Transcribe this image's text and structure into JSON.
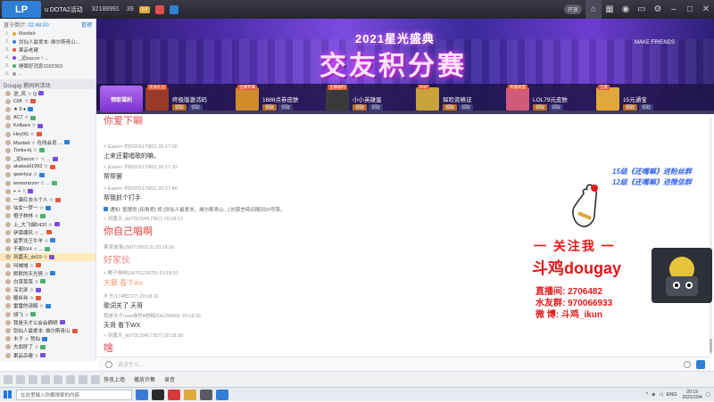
{
  "topbar": {
    "room_title": "u DOTA2活动",
    "room_id": "32188991",
    "fans": "39",
    "level": "Lv",
    "switch_label": "开放",
    "buttons": [
      "home-icon",
      "grid-icon",
      "gamepad-icon",
      "monitor-icon",
      "settings-icon",
      "minimize-icon",
      "maximize-icon",
      "close-icon"
    ]
  },
  "left_panel": {
    "header_label": "直守倒计:",
    "header_time": "02:48:00",
    "header_link": "管理",
    "rank": [
      {
        "num": "1.",
        "name": "Mardah"
      },
      {
        "num": "2.",
        "name": "剑仙人最爱本: 维尔斯青山..."
      },
      {
        "num": "3.",
        "name": "果品老建"
      },
      {
        "num": "4.",
        "name": "_远bacon丶..."
      },
      {
        "num": "5.",
        "name": "睡眠好消息1002363"
      },
      {
        "num": "6.",
        "name": "..."
      }
    ],
    "section_label": "Dougay 鹅妈妈活动",
    "users": [
      "逆_风 ☆ Q",
      "Cliff. ☆",
      "★ 9 ♦",
      "AC7 ☆",
      "Kelbara ☆",
      "Hey0G ☆",
      "Mardah ☆ 在线会员 ...",
      "Tonks-kj ☆",
      "_远bacon丶 ☆ ...",
      "akatsuki1993 ☆",
      "qwertyui ☆",
      "wowsnizzer ☆ ...",
      "+ + ☆",
      "一袭红衣斗个人 ☆",
      "仙女一梦一 ☆",
      "橙子林林 ☆",
      "上_大飞烟5420 ☆",
      "伊荣绷风 ☆ ...",
      "留罗兆王牛羊 ☆",
      "千都5X4 ☆ ...",
      "到嘉天_dd19 ☆",
      "叫喊喊 ☆",
      "默默的天光情 ☆",
      "白菜菜菜 ☆",
      "深北柒 ☆",
      "暖丝丝 ☆",
      "雷雷的请解 ☆",
      "胡飞 ☆",
      "我是天才公会会摘明",
      "剑仙人最爱本: 维尔斯青山",
      "木子 ☆ 赞仙",
      "杰朋肝了 ☆",
      "果品杂建 ☆",
      "锯香 ☆"
    ]
  },
  "banner": {
    "year_title": "2021星光盛典",
    "main_title": "交友积分赛",
    "partner": "MAKE FRIENDS",
    "first_label": "领取福利",
    "gifts": [
      {
        "tag": "充值礼包",
        "name": "终极版激活码"
      },
      {
        "tag": "主播专属",
        "name": "1688点券皮肤"
      },
      {
        "tag": "主播福利",
        "name": "小小英雄蛋"
      },
      {
        "tag": "DNF",
        "name": "探险资格证"
      },
      {
        "tag": "英雄联盟",
        "name": "LOL79元皮肤"
      },
      {
        "tag": "王者",
        "name": "15元通宝"
      }
    ],
    "btn_claim": "领取",
    "btn_get": "领取"
  },
  "chat": {
    "cut_top": "你爱下唰",
    "messages": [
      {
        "meta": "< Eason~刘(620117982) 20:17:26",
        "text": "上来还要唱歌的嘛。",
        "style": "normal"
      },
      {
        "meta": "< Eason~刘(620117982) 20:17:33",
        "text": "帮帮罢",
        "style": "normal"
      },
      {
        "meta": "< Eason~刘(620117982) 20:17:40",
        "text": "帮我抓个打手",
        "style": "normal"
      },
      {
        "meta": "",
        "text": "通知: 管理员 [街角呢] 将 [剑仙人最爱本、维尔斯青山...] 的禁言時间隔到20号禁。",
        "style": "sys"
      },
      {
        "meta": "< 到嘉天_dd7f2(39417957) 20:18:12",
        "text": "你自己唱啊",
        "style": "red"
      },
      {
        "meta": "果茶故事(2607790213) 20:18:16",
        "text": "好家伙",
        "style": "pink"
      },
      {
        "meta": "< 椰子林林(2475123675) 20:18:31",
        "text": "天籁 看下wx",
        "style": "orange"
      },
      {
        "meta": "木子(17485127) 20:18:31",
        "text": "歌词关了   天哥",
        "style": "normal"
      },
      {
        "meta": "我是天才rose缘附♥桃梅(64128899) 20:18:32",
        "text": "天哥  看下WX",
        "style": "normal"
      },
      {
        "meta": "< 到嘉天_dd7f2(39417957) 20:18:39",
        "text": "啥",
        "style": "red"
      }
    ],
    "input_placeholder": "说点什么..."
  },
  "overlay": {
    "group1": "15级《还嘴嘛》进粉丝群",
    "group2": "12级《还嘴嘛》进微信群",
    "follow": "一 关注我 一",
    "name": "斗鸡dougay",
    "live_label": "直播间: 2706482",
    "fan_group": "水友群: 970066933",
    "weibo": "微  博: 斗鸡_ikun"
  },
  "bottombar": {
    "items": [
      "快攻上墙",
      "播放许集",
      "录音"
    ]
  },
  "taskbar": {
    "search_placeholder": "在这里输入你要搜索的内容",
    "tray_lang": "ENG",
    "time": "20:19",
    "date": "2021/10/4"
  },
  "colors": {
    "accent": "#2f7fd6",
    "overlay_red": "#e01a1a",
    "overlay_blue": "#3a6ae6",
    "banner_purple": "#6c3dd0"
  }
}
